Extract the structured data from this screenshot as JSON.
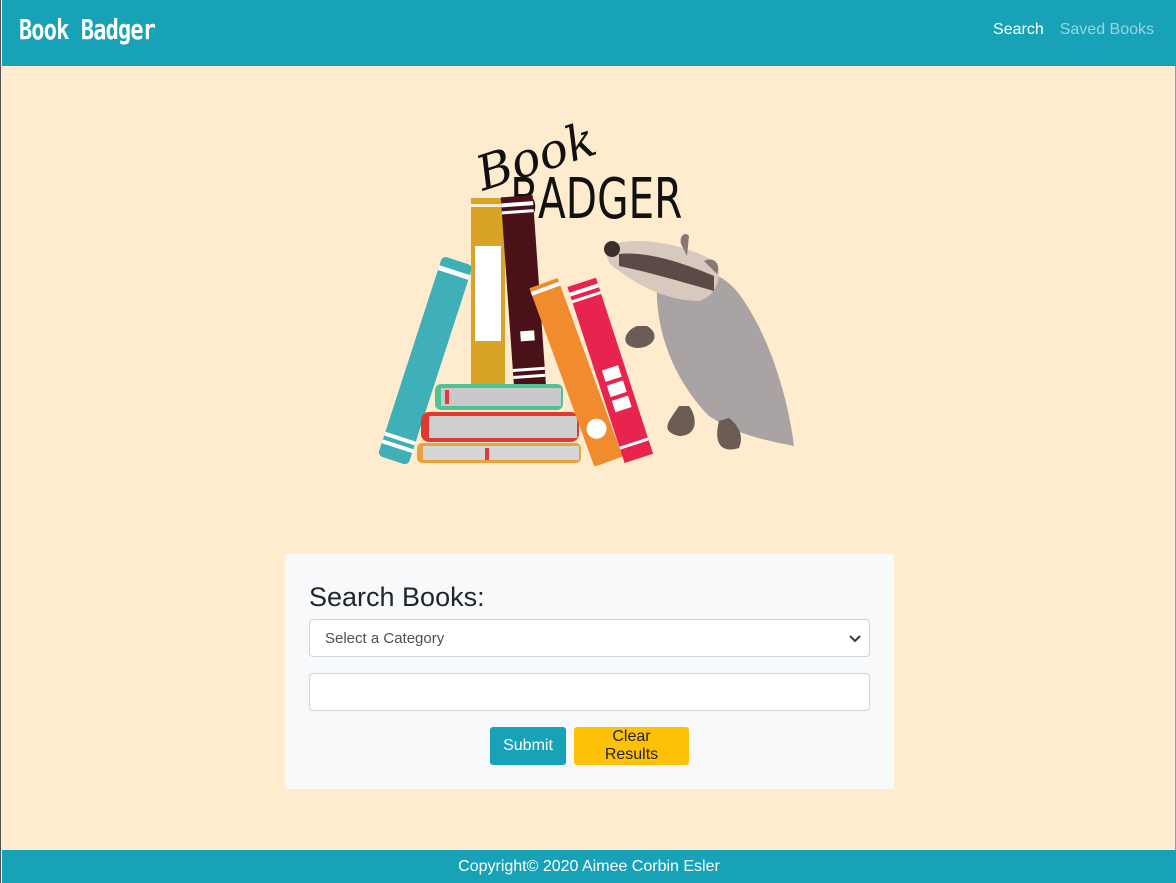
{
  "navbar": {
    "brand": "Book Badger",
    "links": [
      {
        "label": "Search"
      },
      {
        "label": "Saved Books"
      }
    ]
  },
  "hero": {
    "logo_word_1": "Book",
    "logo_word_2": "BADGER"
  },
  "search": {
    "heading": "Search Books:",
    "category_select": "Select a Category",
    "query_value": "",
    "submit_label": "Submit",
    "clear_label": "Clear Results"
  },
  "footer": {
    "text": "Copyright© 2020 Aimee Corbin Esler"
  },
  "colors": {
    "primary": "#17a2b8",
    "background": "#ffecce",
    "warning": "#ffc107",
    "card": "#f8f9fa"
  },
  "icons": [
    "chevron-down-icon"
  ]
}
